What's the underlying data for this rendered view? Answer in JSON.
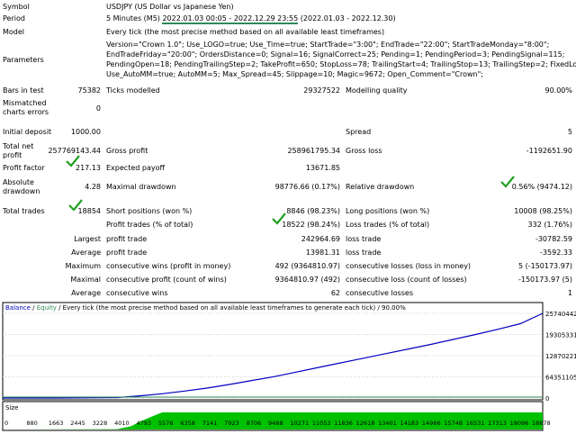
{
  "labels": {
    "symbol": "Symbol",
    "period": "Period",
    "model": "Model",
    "parameters": "Parameters",
    "bars_in_test": "Bars in test",
    "ticks_modelled": "Ticks modelled",
    "modelling_quality": "Modelling quality",
    "mismatched_1": "Mismatched",
    "mismatched_2": "charts errors",
    "initial_deposit": "Initial deposit",
    "spread": "Spread",
    "total_net_1": "Total net",
    "total_net_2": "profit",
    "gross_profit": "Gross profit",
    "gross_loss": "Gross loss",
    "profit_factor": "Profit factor",
    "expected_payoff": "Expected payoff",
    "absolute_1": "Absolute",
    "absolute_2": "drawdown",
    "maximal_drawdown": "Maximal drawdown",
    "relative_drawdown": "Relative drawdown",
    "total_trades": "Total trades",
    "short_positions": "Short positions (won %)",
    "long_positions": "Long positions (won %)",
    "profit_trades": "Profit trades (% of total)",
    "loss_trades": "Loss trades (% of total)",
    "largest": "Largest",
    "average": "Average",
    "maximum": "Maximum",
    "maximal": "Maximal",
    "average2": "Average",
    "profit_trade": "profit trade",
    "loss_trade": "loss trade",
    "cons_wins_money": "consecutive wins (profit in money)",
    "cons_losses_money": "consecutive losses (loss in money)",
    "cons_profit_count": "consecutive profit (count of wins)",
    "cons_loss_count": "consecutive loss (count of losses)",
    "cons_wins": "consecutive wins",
    "cons_losses": "consecutive losses"
  },
  "values": {
    "symbol": "USDJPY (US Dollar vs Japanese Yen)",
    "period_a": "5 Minutes (M5) ",
    "period_b": "2022.01.03 00:05 - 2022.12.29 23:55",
    "period_c": " (2022.01.03 - 2022.12.30)",
    "model": "Every tick (the most precise method based on all available least timeframes)",
    "params_1": "Version=\"Crown 1.0\"; Use_LOGO=true; Use_Time=true; StartTrade=\"3:00\"; EndTrade=\"22:00\"; StartTradeMonday=\"8:00\";",
    "params_2": "EndTradeFriday=\"20:00\"; OrdersDistance=0; Signal=16; SignalCorrect=25; Pending=1; PendingPeriod=3; PendingSignal=115;",
    "params_3": "PendingOpen=18; PendingTrailingStep=2; TakeProfit=650; StopLoss=78; TrailingStart=4; TrailingStop=13; TrailingStep=2; FixedLot=0.1;",
    "params_4": "Use_AutoMM=true; AutoMM=5; Max_Spread=45; Slippage=10; Magic=9672; Open_Comment=\"Crown\";",
    "bars_in_test": "75382",
    "ticks_modelled": "29327522",
    "modelling_quality": "90.00%",
    "mismatched": "0",
    "initial_deposit": "1000.00",
    "spread": "5",
    "total_net": "257769143.44",
    "gross_profit": "258961795.34",
    "gross_loss": "-1192651.90",
    "profit_factor": "217.13",
    "expected_payoff": "13671.85",
    "absolute_drawdown": "4.28",
    "maximal_drawdown": "98776.66 (0.17%)",
    "relative_drawdown": "0.56% (9474.12)",
    "total_trades": "18854",
    "short_positions": "8846 (98.23%)",
    "long_positions": "10008 (98.25%)",
    "profit_trades": "18522 (98.24%)",
    "loss_trades": "332 (1.76%)",
    "largest_profit": "242964.69",
    "largest_loss": "-30782.59",
    "average_profit": "13981.31",
    "average_loss": "-3592.33",
    "max_cons_wins": "492 (9364810.97)",
    "max_cons_losses": "5 (-150173.97)",
    "maximal_cons_profit": "9364810.97 (492)",
    "maximal_cons_loss": "-150173.97 (5)",
    "avg_cons_wins": "62",
    "avg_cons_losses": "1"
  },
  "chart": {
    "legend_balance": "Balance",
    "legend_sep1": " / ",
    "legend_equity": "Equity",
    "legend_rest": " / Every tick (the most precise method based on all available least timeframes to generate each tick) / 90.00%",
    "size_label": "Size",
    "balance_color": "#0000c0",
    "equity_color": "#2e8b57",
    "size_color": "#00c000",
    "y_ticks": [
      "25740442",
      "19305331",
      "12870221",
      "64351105",
      "0"
    ],
    "x_ticks": [
      "0",
      "880",
      "1663",
      "2445",
      "3228",
      "4010",
      "4793",
      "5576",
      "6358",
      "7141",
      "7923",
      "8706",
      "9488",
      "10271",
      "11053",
      "11836",
      "12618",
      "13401",
      "14183",
      "14966",
      "15748",
      "16531",
      "17313",
      "18096",
      "18878"
    ]
  },
  "chart_data": {
    "type": "line",
    "x": [
      0,
      2000,
      4010,
      4793,
      5576,
      6358,
      7141,
      7923,
      8706,
      9488,
      10271,
      11053,
      11836,
      12618,
      13401,
      14183,
      14966,
      15748,
      16531,
      17313,
      18096,
      18878
    ],
    "series": [
      {
        "name": "Balance",
        "values": [
          1000,
          1000,
          150000,
          650000,
          1300000,
          2100000,
          3000000,
          4100000,
          5300000,
          6500000,
          7900000,
          9300000,
          10700000,
          12100000,
          13500000,
          14900000,
          16300000,
          17800000,
          19300000,
          20900000,
          22600000,
          25740442
        ]
      }
    ],
    "size_series": {
      "x": [
        0,
        4010,
        4500,
        4793,
        5200,
        5576,
        18878
      ],
      "values": [
        0,
        0.02,
        0.2,
        0.45,
        0.75,
        1,
        1
      ]
    },
    "ylim": [
      0,
      25740442
    ],
    "xlim": [
      0,
      18878
    ]
  }
}
